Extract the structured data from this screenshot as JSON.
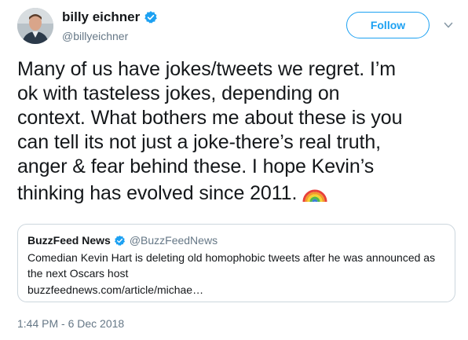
{
  "author": {
    "display_name": "billy eichner",
    "handle": "@billyeichner",
    "verified": true
  },
  "follow_button": {
    "label": "Follow"
  },
  "tweet": {
    "lines": [
      "Many of us have jokes/tweets we regret. I’m",
      "ok with tasteless jokes, depending on",
      "context. What bothers me about these is you",
      "can tell its not just a joke-there’s real truth,",
      "anger & fear behind these. I hope Kevin’s",
      "thinking has evolved since 2011."
    ],
    "emoji": "rainbow-emoji"
  },
  "quoted_tweet": {
    "name": "BuzzFeed News",
    "handle": "@BuzzFeedNews",
    "verified": true,
    "text": "Comedian Kevin Hart is deleting old homophobic tweets after he was announced as the next Oscars host",
    "link": "buzzfeednews.com/article/michae…"
  },
  "timestamp": "1:44 PM - 6 Dec 2018",
  "icons": {
    "verified": "verified-badge-icon",
    "more": "chevron-down-icon",
    "rainbow": "rainbow-icon"
  },
  "colors": {
    "accent": "#1da1f2",
    "text": "#14171a",
    "secondary_text": "#657786",
    "border": "#ccd6dd"
  }
}
